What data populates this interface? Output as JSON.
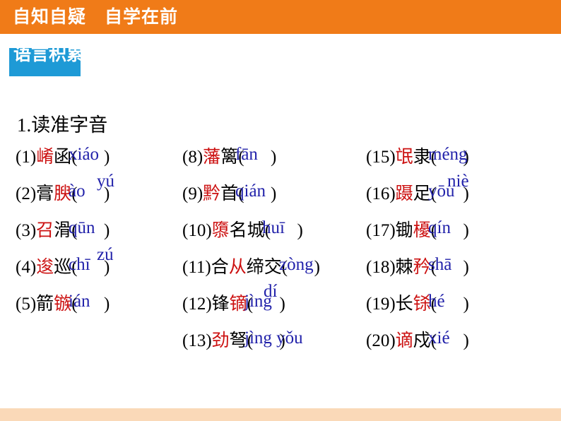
{
  "header": {
    "title": "自知自疑　自学在前",
    "bg_color": "#F07B18",
    "text_color": "#FFFFFF"
  },
  "section_chip": {
    "label": "语言积累",
    "bg_color": "#1E9AD6",
    "text_color": "#FFFFFF"
  },
  "heading": "1.读准字音",
  "colors": {
    "highlight_char": "#CC1111",
    "pinyin": "#2222AA",
    "body_text": "#000000",
    "footer_strip": "#FAD9B8"
  },
  "columns": [
    {
      "name": "column-left",
      "items": [
        {
          "index": "(1)",
          "word_pre": "",
          "word_hl": "崤",
          "word_post": "函",
          "open": "(",
          "pinyin": "xiáo",
          "close": ")",
          "pinyin2": "yú",
          "has_second_line": true
        },
        {
          "index": "(2)",
          "word_pre": "膏",
          "word_hl": "腴",
          "word_post": "",
          "open": "(",
          "pinyin": "ào",
          "close": ")",
          "pinyin2": "",
          "has_second_line": false
        },
        {
          "index": "(3)",
          "word_pre": "",
          "word_hl": "召",
          "word_post": "滑",
          "open": "(",
          "pinyin": "qūn",
          "close": ")",
          "pinyin2": "zú",
          "has_second_line": true
        },
        {
          "index": "(4)",
          "word_pre": "",
          "word_hl": "逡",
          "word_post": "巡",
          "open": "(",
          "pinyin": "chī",
          "close": ")",
          "pinyin2": "",
          "has_second_line": false
        },
        {
          "index": "(5)",
          "word_pre": "箭",
          "word_hl": "镞",
          "word_post": "",
          "open": "(",
          "pinyin": "ián",
          "close": ")",
          "pinyin2": "",
          "has_second_line": false
        }
      ]
    },
    {
      "name": "column-middle",
      "items": [
        {
          "index": "(8)",
          "word_pre": "",
          "word_hl": "藩",
          "word_post": "篱",
          "open": "(",
          "pinyin": "fān",
          "close": ")",
          "pinyin2": "",
          "has_second_line": false
        },
        {
          "index": "(9)",
          "word_pre": "",
          "word_hl": "黔",
          "word_post": "首",
          "open": "(",
          "pinyin": "qián",
          "close": ")",
          "pinyin2": "",
          "has_second_line": false
        },
        {
          "index": "(10)",
          "word_pre": "",
          "word_hl": "隳",
          "word_post": "名城",
          "open": "(",
          "pinyin": "huī",
          "close": ")",
          "pinyin2": "",
          "has_second_line": false
        },
        {
          "index": "(11)",
          "word_pre": "合",
          "word_hl": "从",
          "word_post": "缔交",
          "open": "(",
          "pinyin": "zòng",
          "close": ")",
          "pinyin2": "dí",
          "has_second_line": true
        },
        {
          "index": "(12)",
          "word_pre": "锋",
          "word_hl": "镝",
          "word_post": "",
          "open": "(",
          "pinyin": "jìng",
          "close": ")",
          "pinyin2": "",
          "has_second_line": false
        },
        {
          "index": "(13)",
          "word_pre": "",
          "word_hl": "劲",
          "word_post": "弩",
          "open": "(",
          "pinyin": "jìng yǒu",
          "close": ")",
          "pinyin2": "",
          "has_second_line": false
        }
      ]
    },
    {
      "name": "column-right",
      "items": [
        {
          "index": "(15)",
          "word_pre": "",
          "word_hl": "氓",
          "word_post": "隶",
          "open": "(",
          "pinyin": "méng",
          "close": ")",
          "pinyin2": "niè",
          "has_second_line": true
        },
        {
          "index": "(16)",
          "word_pre": "",
          "word_hl": "蹑",
          "word_post": "足",
          "open": "(",
          "pinyin": "yōu",
          "close": ")",
          "pinyin2": "",
          "has_second_line": false
        },
        {
          "index": "(17)",
          "word_pre": "锄",
          "word_hl": "櫌",
          "word_post": "",
          "open": "(",
          "pinyin": "qín",
          "close": ")",
          "pinyin2": "",
          "has_second_line": false
        },
        {
          "index": "(18)",
          "word_pre": "棘",
          "word_hl": "矜",
          "word_post": "",
          "open": "(",
          "pinyin": "shā",
          "close": ")",
          "pinyin2": "",
          "has_second_line": false
        },
        {
          "index": "(19)",
          "word_pre": "长",
          "word_hl": "铩",
          "word_post": "",
          "open": "(",
          "pinyin": "hé",
          "close": ")",
          "pinyin2": "",
          "has_second_line": false
        },
        {
          "index": "(20)",
          "word_pre": "",
          "word_hl": "谪",
          "word_post": "戍",
          "open": "(",
          "pinyin": "xié",
          "close": ")",
          "pinyin2": "",
          "has_second_line": false
        }
      ]
    }
  ]
}
